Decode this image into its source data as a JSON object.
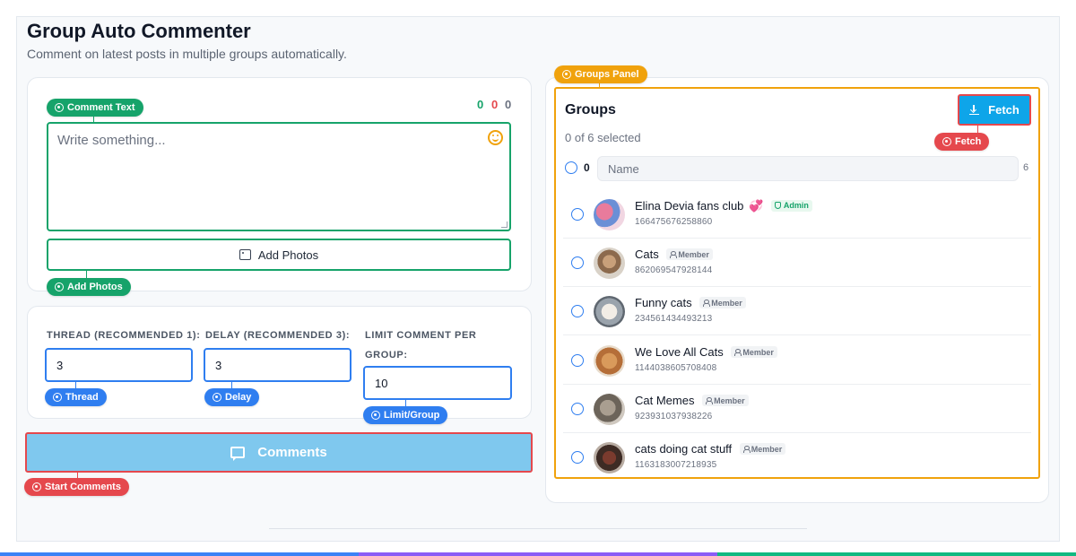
{
  "page": {
    "title": "Group Auto Commenter",
    "subtitle": "Comment on latest posts in multiple groups automatically."
  },
  "comment": {
    "tag": "Comment Text",
    "placeholder": "Write something...",
    "counters": [
      "0",
      "0",
      "0"
    ],
    "add_photos_label": "Add Photos",
    "add_photos_tag": "Add Photos"
  },
  "settings": {
    "thread_label": "THREAD (RECOMMENDED 1):",
    "thread_value": "3",
    "thread_tag": "Thread",
    "delay_label": "DELAY (RECOMMENDED 3):",
    "delay_value": "3",
    "delay_tag": "Delay",
    "limit_label_line1": "LIMIT COMMENT PER",
    "limit_label_line2": "GROUP:",
    "limit_value": "10",
    "limit_tag": "Limit/Group"
  },
  "actions": {
    "comments_label": "Comments",
    "start_tag": "Start Comments"
  },
  "groups": {
    "panel_tag": "Groups Panel",
    "title": "Groups",
    "selected_text": "0 of 6 selected",
    "fetch_label": "Fetch",
    "fetch_tag": "Fetch",
    "selected_count": "0",
    "name_placeholder": "Name",
    "total_count": "6",
    "items": [
      {
        "name": "Elina Devia fans club",
        "id": "166475676258860",
        "role": "Admin",
        "heart": "💞"
      },
      {
        "name": "Cats",
        "id": "862069547928144",
        "role": "Member"
      },
      {
        "name": "Funny cats",
        "id": "234561434493213",
        "role": "Member"
      },
      {
        "name": "We Love All Cats",
        "id": "1144038605708408",
        "role": "Member"
      },
      {
        "name": "Cat Memes",
        "id": "923931037938226",
        "role": "Member"
      },
      {
        "name": "cats doing cat stuff",
        "id": "1163183007218935",
        "role": "Member"
      }
    ]
  },
  "colors": {
    "green": "#16a36a",
    "blue": "#2f7ef0",
    "red": "#e5484d",
    "orange": "#f0a20c",
    "sky": "#0ea5e9",
    "button_disabled": "#7fc8ee"
  }
}
